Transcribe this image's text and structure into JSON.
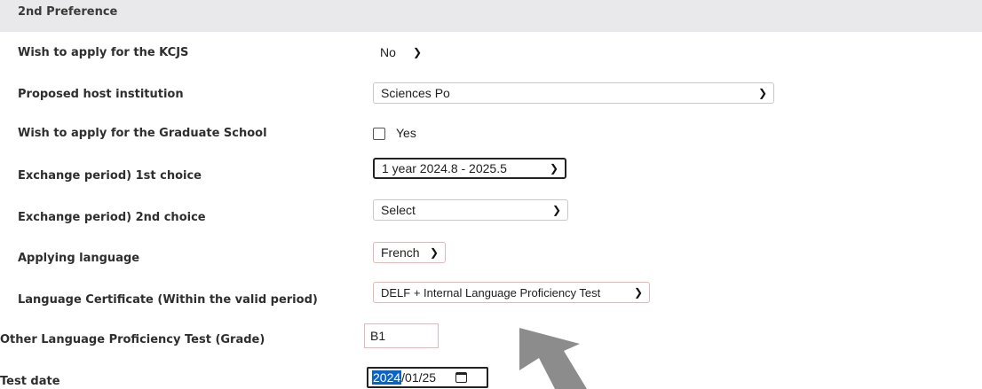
{
  "section": {
    "title": "2nd Preference"
  },
  "rows": {
    "kcjs": {
      "label": "Wish to apply for the KCJS",
      "value": "No"
    },
    "host": {
      "label": "Proposed host institution",
      "value": "Sciences Po"
    },
    "grad": {
      "label": "Wish to apply for the Graduate School",
      "option": "Yes",
      "checked": false
    },
    "period1": {
      "label": "Exchange period) 1st choice",
      "value": "1 year 2024.8 - 2025.5"
    },
    "period2": {
      "label": "Exchange period) 2nd choice",
      "value": "Select"
    },
    "language": {
      "label": "Applying language",
      "value": "French"
    },
    "certificate": {
      "label": "Language Certificate (Within the valid period)",
      "value": "DELF + Internal Language Proficiency Test"
    },
    "other_test": {
      "label": "Other Language Proficiency Test (Grade)",
      "value": "B1"
    },
    "test_date": {
      "label": "Test date",
      "year": "2024",
      "rest": "/01/25"
    }
  },
  "icons": {
    "chevron": "chevron-down-icon",
    "calendar": "calendar-icon",
    "arrow": "arrow-pointer-icon"
  },
  "colors": {
    "header_bg": "#e9e9eb",
    "highlight": "#0a63c9",
    "arrow": "#8c8c8c"
  }
}
